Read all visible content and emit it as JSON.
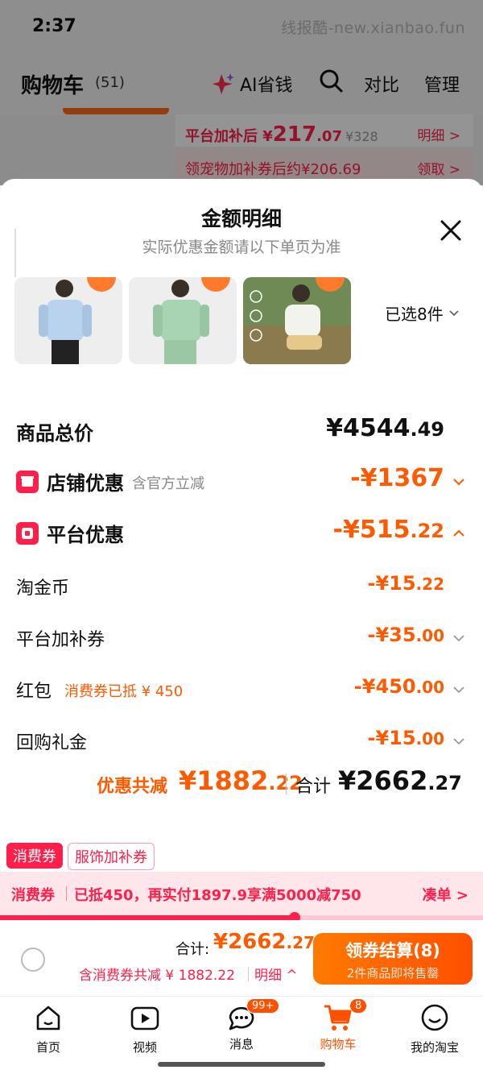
{
  "status": {
    "time": "2:37",
    "watermark": "线报酷-new.xianbao.fun"
  },
  "header": {
    "title": "购物车",
    "count": "(51)",
    "ai_label": "AI省钱",
    "compare": "对比",
    "manage": "管理"
  },
  "behind": {
    "price_prefix": "平台加补后 ¥",
    "price_int": "217",
    "price_dec": ".07",
    "price_old": "¥328",
    "detail": "明细 >",
    "coupon": "领宠物加补券后约¥206.69",
    "claim": "领取 >"
  },
  "sheet": {
    "title": "金额明细",
    "subtitle": "实际优惠金额请以下单页为准",
    "selected": "已选8件"
  },
  "rows": {
    "total": {
      "label": "商品总价",
      "amount_int": "¥4544",
      "amount_dec": ".49"
    },
    "shop": {
      "label": "店铺优惠",
      "note": "含官方立减",
      "amount_int": "-¥1367",
      "amount_dec": ""
    },
    "platform": {
      "label": "平台优惠",
      "amount_int": "-¥515",
      "amount_dec": ".22"
    },
    "coins": {
      "label": "淘金币",
      "amount_int": "-¥15",
      "amount_dec": ".22"
    },
    "subsidy": {
      "label": "平台加补券",
      "amount_int": "-¥35",
      "amount_dec": ".00"
    },
    "redpack": {
      "label": "红包",
      "note": "消费券已抵 ¥ 450",
      "amount_int": "-¥450",
      "amount_dec": ".00"
    },
    "giftcash": {
      "label": "回购礼金",
      "amount_int": "-¥15",
      "amount_dec": ".00"
    }
  },
  "summary": {
    "save_label": "优惠共减",
    "save_int": "¥1882",
    "save_dec": ".22",
    "sum_label": "合计",
    "sum_int": "¥2662",
    "sum_dec": ".27"
  },
  "coupon": {
    "tab1": "消费券",
    "tab2": "服饰加补券",
    "bar_tag": "消费券",
    "bar_text": "已抵450，再实付1897.9享满5000减750",
    "bar_link": "凑单 >",
    "progress": 0.61
  },
  "checkout": {
    "sum_label": "合计:",
    "sum_int": "¥2662",
    "sum_dec": ".27",
    "saving": "含消费券共减 ¥ 1882.22",
    "detail": "明细 ^",
    "btn_main": "领券结算(8)",
    "btn_sub": "2件商品即将售罄"
  },
  "tabs": [
    {
      "label": "首页"
    },
    {
      "label": "视频"
    },
    {
      "label": "消息",
      "badge": "99+"
    },
    {
      "label": "购物车",
      "badge": "8"
    },
    {
      "label": "我的淘宝"
    }
  ],
  "colors": {
    "accent": "#ff5a00",
    "red": "#ff1f4a"
  }
}
